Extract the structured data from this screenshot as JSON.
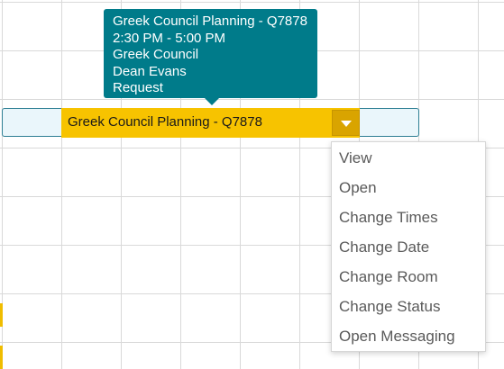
{
  "tooltip": {
    "title": "Greek Council Planning - Q7878",
    "time": "2:30 PM - 5:00 PM",
    "group": "Greek Council",
    "contact": "Dean Evans",
    "status": "Request"
  },
  "event": {
    "title": "Greek Council Planning - Q7878",
    "menu_toggle_icon": "caret-down-icon"
  },
  "context_menu": {
    "items": [
      {
        "label": "View"
      },
      {
        "label": "Open"
      },
      {
        "label": "Change Times"
      },
      {
        "label": "Change Date"
      },
      {
        "label": "Change Room"
      },
      {
        "label": "Change Status"
      },
      {
        "label": "Open Messaging"
      }
    ]
  },
  "colors": {
    "event": "#f7c300",
    "event_toggle": "#d9a400",
    "tooltip": "#007b8a",
    "selection_border": "#2d7e93",
    "selection_fill": "#eaf6fb",
    "grid": "#d9d9d9",
    "menu_text": "#5a5a5a"
  }
}
